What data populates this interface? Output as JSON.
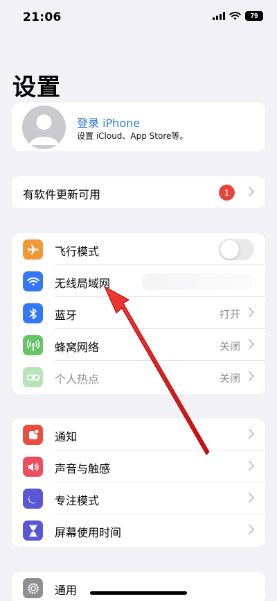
{
  "status_bar": {
    "time": "21:06",
    "battery": "79"
  },
  "page_title": "设置",
  "profile": {
    "name": "登录 iPhone",
    "subtitle": "设置 iCloud、App Store等。"
  },
  "update": {
    "label": "有软件更新可用",
    "badge": "1"
  },
  "network": {
    "airplane": {
      "label": "飞行模式",
      "enabled": false
    },
    "wifi": {
      "label": "无线局域网"
    },
    "bluetooth": {
      "label": "蓝牙",
      "value": "打开"
    },
    "cellular": {
      "label": "蜂窝网络",
      "value": "关闭"
    },
    "hotspot": {
      "label": "个人热点",
      "value": "关闭"
    }
  },
  "notifications": {
    "notify": {
      "label": "通知"
    },
    "sounds": {
      "label": "声音与触感"
    },
    "focus": {
      "label": "专注模式"
    },
    "screentime": {
      "label": "屏幕使用时间"
    }
  },
  "general": {
    "label": "通用"
  },
  "colors": {
    "airplane": "#f09a37",
    "wifi": "#3478f6",
    "bluetooth": "#3478f6",
    "cellular": "#65c466",
    "hotspot": "#65c466",
    "notify": "#eb4d3d",
    "sounds": "#eb4e5f",
    "focus": "#5b56d6",
    "screentime": "#5b56d6",
    "general": "#8e8e93",
    "annotation_arrow": "#e11c1c"
  },
  "icons": {
    "airplane": "airplane-icon",
    "wifi": "wifi-icon",
    "bluetooth": "bluetooth-icon",
    "cellular": "cellular-antenna-icon",
    "hotspot": "hotspot-link-icon",
    "notify": "bell-icon",
    "sounds": "speaker-icon",
    "focus": "moon-icon",
    "screentime": "hourglass-icon",
    "general": "gear-icon"
  }
}
